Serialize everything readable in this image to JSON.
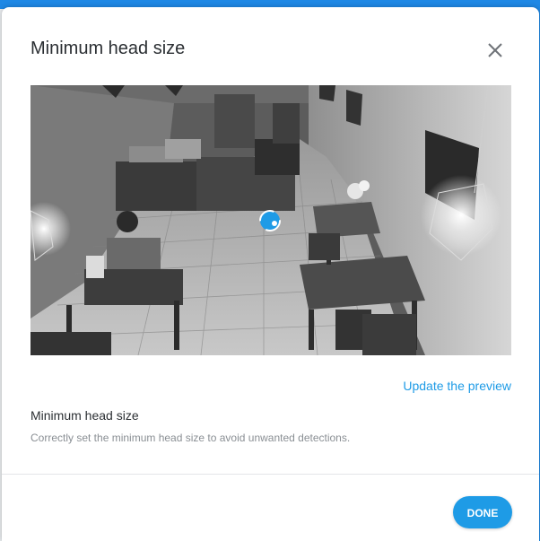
{
  "dialog": {
    "title": "Minimum head size",
    "close_icon": "close-icon"
  },
  "preview": {
    "image": "grayscale camera view of a cafe interior",
    "marker_icon": "head-size-marker-icon"
  },
  "actions": {
    "update_preview_label": "Update the preview",
    "done_label": "DONE"
  },
  "setting": {
    "label": "Minimum head size",
    "help": "Correctly set the minimum head size to avoid unwanted detections."
  },
  "colors": {
    "accent": "#1e9be6",
    "header_bar": "#1e88e5",
    "title_text": "#2b2f33",
    "help_text": "#8a8f94"
  }
}
